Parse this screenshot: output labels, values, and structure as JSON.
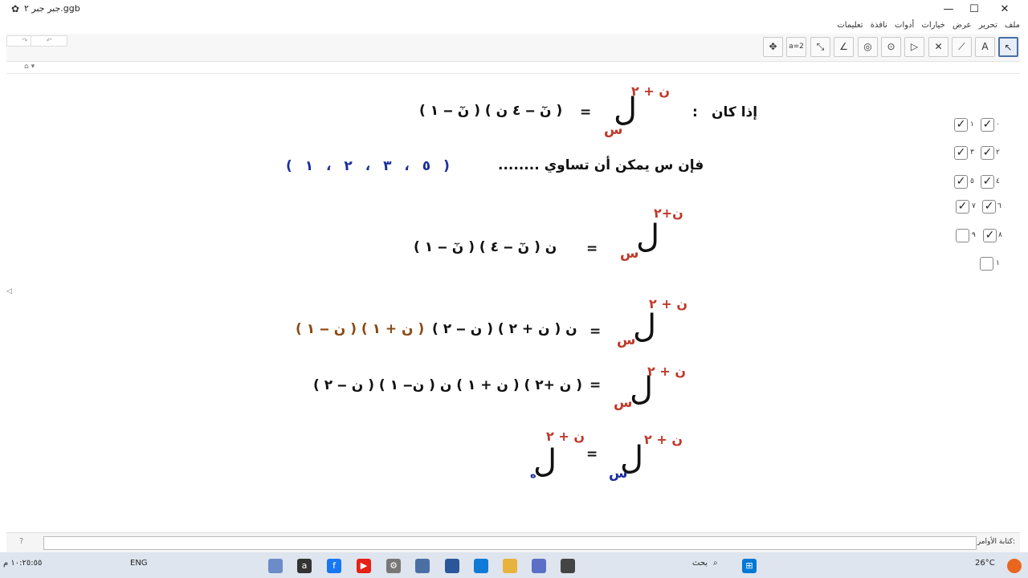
{
  "window": {
    "title": "جبر جبر ٢.ggb",
    "gear": "✿",
    "minimize": "—",
    "maximize": "☐",
    "close": "✕"
  },
  "menu": [
    "ملف",
    "تحرير",
    "عرض",
    "خيارات",
    "أدوات",
    "نافذة",
    "تعليمات"
  ],
  "toolbar": {
    "undo": "↶",
    "redo": "↷",
    "tools": [
      {
        "name": "move-tool",
        "glyph": "↖"
      },
      {
        "name": "text-tool",
        "glyph": "A"
      },
      {
        "name": "segment-tool",
        "glyph": "⟋"
      },
      {
        "name": "perpendicular-tool",
        "glyph": "✕"
      },
      {
        "name": "polygon-tool",
        "glyph": "▷"
      },
      {
        "name": "circle-tool",
        "glyph": "⊙"
      },
      {
        "name": "ellipse-tool",
        "glyph": "◎"
      },
      {
        "name": "angle-tool",
        "glyph": "∠"
      },
      {
        "name": "reflect-tool",
        "glyph": "⤡"
      },
      {
        "name": "slider-tool",
        "glyph": "a=2"
      },
      {
        "name": "move-view-tool",
        "glyph": "✥"
      }
    ]
  },
  "graphics": {
    "line1": {
      "if_was": "إذا كان",
      "colon": ":",
      "L": "ل",
      "sub_s": "س",
      "sup": "ن + ٢",
      "eq": "=",
      "rhs": "( نٓ ‒ ٤ ن ) ( نٓ ‒ ١ )"
    },
    "line2": {
      "question": "فإن س يمكن أن تساوي ........",
      "options": "( ٥ ، ٣ ، ٢ ، ١ )"
    },
    "line3": {
      "L": "ل",
      "sub_s": "س",
      "sup": "ن+٢",
      "eq": "=",
      "rhs": "ن ( نٓ ‒ ٤ ) ( نٓ ‒ ١ )"
    },
    "line4": {
      "L": "ل",
      "sub_s": "س",
      "sup": "ن + ٢",
      "eq": "=",
      "rhs_black": "ن ( ن + ٢ ) ( ن ‒ ٢ )",
      "rhs_brown": "( ن + ١ ) ( ن ‒ ١ )"
    },
    "line5": {
      "L": "ل",
      "sub_s": "س",
      "sup": "ن + ٢",
      "eq": "=",
      "rhs": "( ن +٢ ) ( ن + ١ ) ن ( ن‒ ١ ) ( ن ‒ ٢ )"
    },
    "line6": {
      "L1": "ل",
      "sub_s": "س",
      "sup1": "ن + ٢",
      "eq": "=",
      "L2": "ل",
      "sub_h": "ه",
      "sup2": "ن + ٢"
    }
  },
  "checkboxes": [
    {
      "label": "٠",
      "checked": true
    },
    {
      "label": "١",
      "checked": true
    },
    {
      "label": "٢",
      "checked": true
    },
    {
      "label": "٣",
      "checked": true
    },
    {
      "label": "٤",
      "checked": true
    },
    {
      "label": "٥",
      "checked": true
    },
    {
      "label": "٦",
      "checked": true
    },
    {
      "label": "٧",
      "checked": true
    },
    {
      "label": "٨",
      "checked": true
    },
    {
      "label": "٩",
      "checked": false
    },
    {
      "label": "١",
      "checked": false
    }
  ],
  "inputbar": {
    "label": "كتابة الأوامر:",
    "help": "?"
  },
  "taskbar": {
    "weather": "26°C",
    "lang": "ENG",
    "time": "١٠:٢٥:٥٥ م",
    "search": "بحث"
  }
}
